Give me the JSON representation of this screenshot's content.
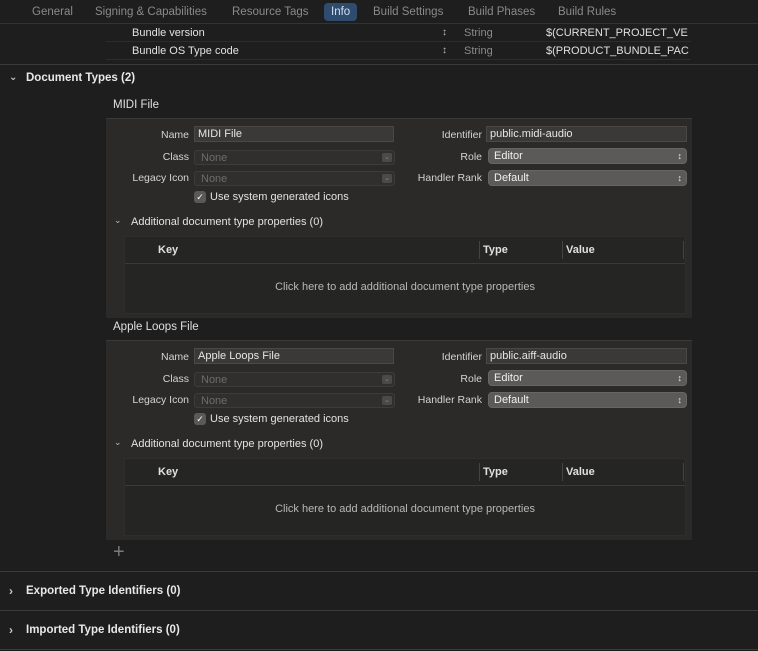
{
  "tabs": [
    "General",
    "Signing & Capabilities",
    "Resource Tags",
    "Info",
    "Build Settings",
    "Build Phases",
    "Build Rules"
  ],
  "active_tab": "Info",
  "plist_rows": [
    {
      "key": "Bundle version",
      "type": "String",
      "value": "$(CURRENT_PROJECT_VE"
    },
    {
      "key": "Bundle OS Type code",
      "type": "String",
      "value": "$(PRODUCT_BUNDLE_PAC"
    }
  ],
  "document_types": {
    "title": "Document Types (2)",
    "items": [
      {
        "title": "MIDI File",
        "name_label": "Name",
        "name_value": "MIDI File",
        "class_label": "Class",
        "class_value": "None",
        "legacy_label": "Legacy Icon",
        "legacy_value": "None",
        "checkbox_label": "Use system generated icons",
        "identifier_label": "Identifier",
        "identifier_value": "public.midi-audio",
        "role_label": "Role",
        "role_value": "Editor",
        "handler_label": "Handler Rank",
        "handler_value": "Default",
        "addl_label": "Additional document type properties (0)",
        "col_key": "Key",
        "col_type": "Type",
        "col_value": "Value",
        "empty_text": "Click here to add additional document type properties"
      },
      {
        "title": "Apple Loops File",
        "name_label": "Name",
        "name_value": "Apple Loops File",
        "class_label": "Class",
        "class_value": "None",
        "legacy_label": "Legacy Icon",
        "legacy_value": "None",
        "checkbox_label": "Use system generated icons",
        "identifier_label": "Identifier",
        "identifier_value": "public.aiff-audio",
        "role_label": "Role",
        "role_value": "Editor",
        "handler_label": "Handler Rank",
        "handler_value": "Default",
        "addl_label": "Additional document type properties (0)",
        "col_key": "Key",
        "col_type": "Type",
        "col_value": "Value",
        "empty_text": "Click here to add additional document type properties"
      }
    ]
  },
  "exported_types": {
    "title": "Exported Type Identifiers (0)"
  },
  "imported_types": {
    "title": "Imported Type Identifiers (0)"
  },
  "icons": {
    "add": "plus-icon",
    "expand": "chevron-right-icon",
    "collapse": "chevron-down-icon",
    "stepper": "up-down-stepper-icon",
    "check": "checkmark-icon"
  }
}
